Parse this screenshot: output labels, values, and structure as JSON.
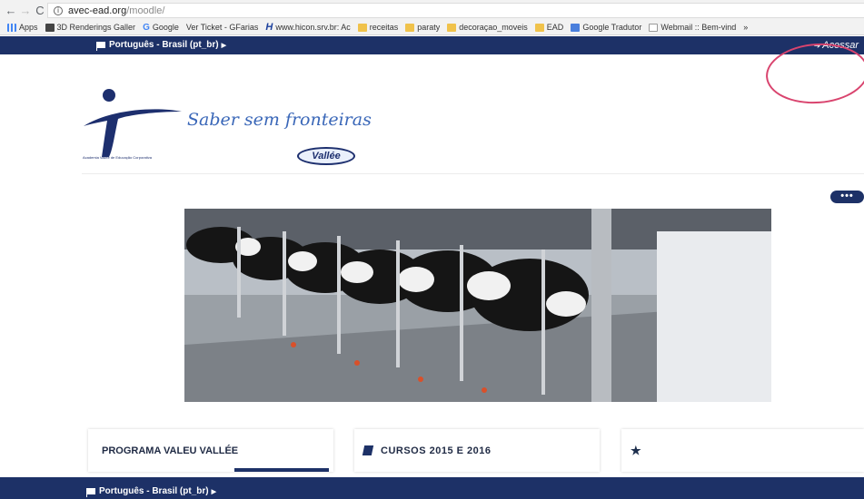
{
  "browser": {
    "back_icon": "←",
    "forward_icon": "→",
    "reload_icon": "C",
    "url_host": "avec-ead.org",
    "url_path": "/moodle/"
  },
  "bookmarks": [
    {
      "label": "Apps",
      "icon": "apps-grid-icon"
    },
    {
      "label": "3D Renderings Galler",
      "icon": "dark-thumb-icon"
    },
    {
      "label": "Google",
      "icon": "google-g-icon"
    },
    {
      "label": "Ver Ticket - GFarias",
      "icon": "none"
    },
    {
      "label": "www.hicon.srv.br: Ac",
      "icon": "hicon-icon"
    },
    {
      "label": "receitas",
      "icon": "folder-icon"
    },
    {
      "label": "paraty",
      "icon": "folder-icon"
    },
    {
      "label": "decoraçao_moveis",
      "icon": "folder-icon"
    },
    {
      "label": "EAD",
      "icon": "folder-icon"
    },
    {
      "label": "Google Tradutor",
      "icon": "translate-icon"
    },
    {
      "label": "Webmail :: Bem-vind",
      "icon": "mail-icon"
    }
  ],
  "bookmarks_more": "»",
  "topnav": {
    "language": "Português - Brasil (pt_br)",
    "login": "Acessar"
  },
  "logo": {
    "tagline": "Saber sem fronteiras",
    "company": "Academia Vallée de Educação Corporativa",
    "brand": "Vallée"
  },
  "carousel_indicator": "•••",
  "cards": {
    "card1_title": "PROGRAMA VALEU VALLÉE",
    "card2_title": "CURSOS 2015 E 2016",
    "card3_icon": "★"
  },
  "footer": {
    "language": "Português - Brasil (pt_br)"
  },
  "colors": {
    "navbar": "#1d3167",
    "tagline": "#3a67b8",
    "annotation_circle": "#d9446e"
  }
}
